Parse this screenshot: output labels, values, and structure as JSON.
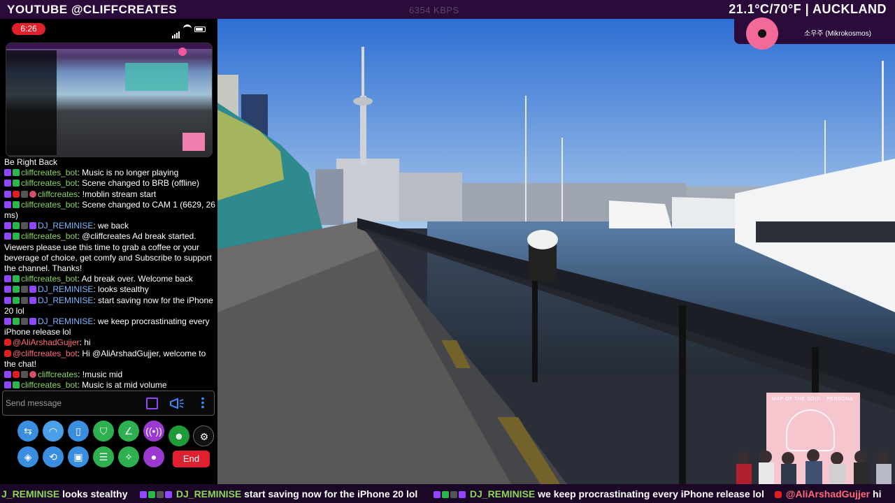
{
  "topbar": {
    "channel": "YOUTUBE @CLIFFCREATES",
    "bitrate": "6354 KBPS",
    "weather": "21.1°C/70°F | AUCKLAND"
  },
  "phone": {
    "time": "6:26",
    "chat": {
      "header": "Be Right Back",
      "messages": [
        {
          "user": "cliffcreates_bot",
          "text": ": Music is no longer playing",
          "platform": "twitch"
        },
        {
          "user": "cliffcreates_bot",
          "text": ": Scene changed to BRB (offline)",
          "platform": "twitch"
        },
        {
          "user": "cliffcreates",
          "text": ": !moblin stream start",
          "platform": "multi"
        },
        {
          "user": "cliffcreates_bot",
          "text": ": Scene changed to CAM 1 (6629, 26 ms)",
          "platform": "twitch"
        },
        {
          "user": "DJ_REMINISE",
          "text": ": we back",
          "platform": "twitch-sub"
        },
        {
          "user": "cliffcreates_bot",
          "text": ": @cliffcreates Ad break started. Viewers please use this time to grab a coffee or your beverage of choice, get comfy and Subscribe to support the channel. Thanks!",
          "platform": "twitch"
        },
        {
          "user": "cliffcreates_bot",
          "text": ": Ad break over. Welcome back",
          "platform": "twitch"
        },
        {
          "user": "DJ_REMINISE",
          "text": ": looks stealthy",
          "platform": "twitch-sub"
        },
        {
          "user": "DJ_REMINISE",
          "text": ": start saving now for the iPhone 20 lol",
          "platform": "twitch-sub"
        },
        {
          "user": "DJ_REMINISE",
          "text": ": we keep procrastinating every iPhone release lol",
          "platform": "twitch-sub"
        },
        {
          "user": "@AliArshadGujjer",
          "text": ": hi",
          "platform": "youtube"
        },
        {
          "user": "@cliffcreates_bot",
          "text": ": Hi @AliArshadGujjer, welcome to the chat!",
          "platform": "youtube"
        },
        {
          "user": "cliffcreates",
          "text": ": !music mid",
          "platform": "multi"
        },
        {
          "user": "cliffcreates_bot",
          "text": ": Music is at mid volume",
          "platform": "twitch"
        }
      ]
    },
    "input_placeholder": "Send message",
    "end_label": "End"
  },
  "music": {
    "song": "소우주 (Mikrokosmos)",
    "album_title": "MAP OF THE SOUL : PERSONA"
  },
  "ticker": [
    {
      "user": "J_REMINISE",
      "text": "looks stealthy"
    },
    {
      "user": "DJ_REMINISE",
      "text": "start saving now for the iPhone 20 lol"
    },
    {
      "user": "DJ_REMINISE",
      "text": "we keep procrastinating every iPhone release lol"
    },
    {
      "user": "@AliArshadGujjer",
      "text": "hi"
    }
  ],
  "colors": {
    "bar_purple": "#2a0b3a",
    "chat_green": "#8ed65a",
    "youtube_red": "#ff6a7a",
    "end_red": "#e02030"
  }
}
